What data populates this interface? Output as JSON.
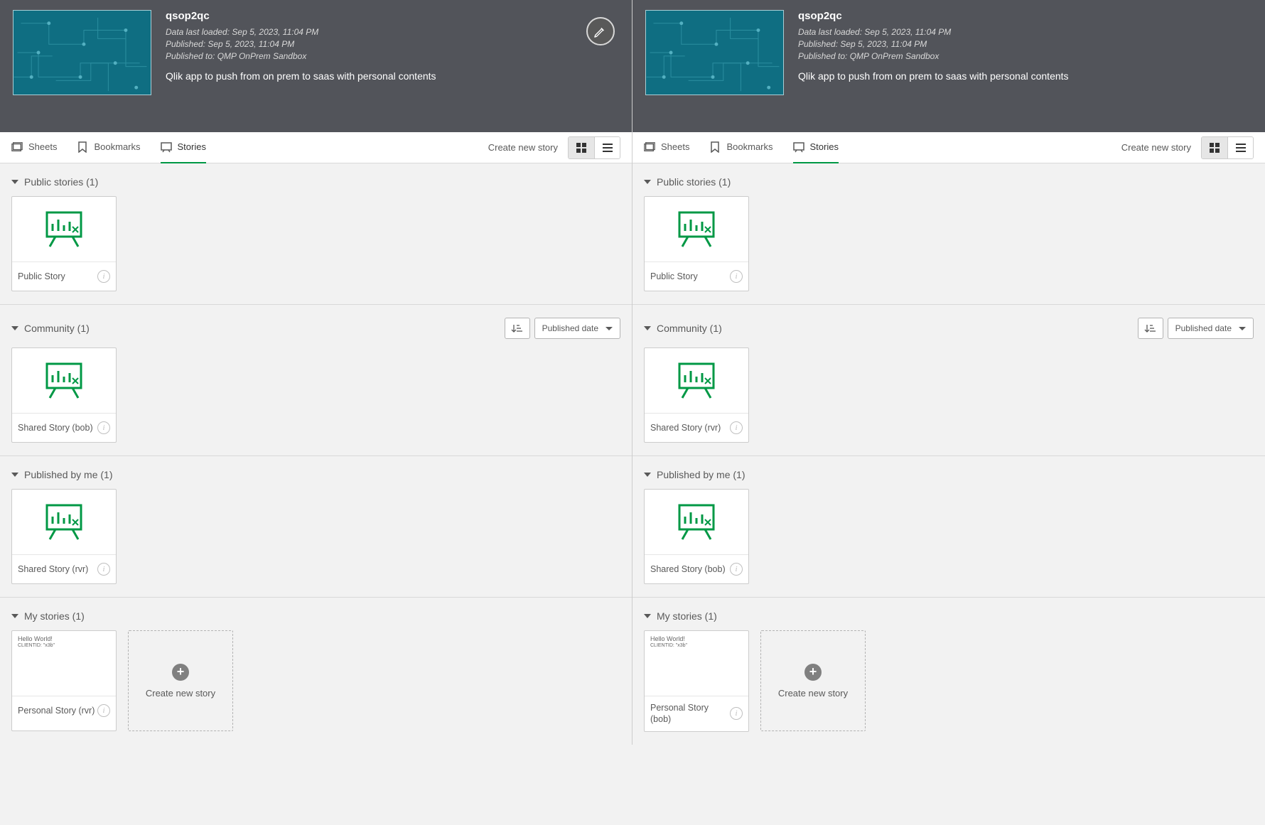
{
  "panes": [
    {
      "key": "left",
      "show_edit_button": true,
      "app_title": "qsop2qc",
      "data_last_loaded": "Data last loaded: Sep 5, 2023, 11:04 PM",
      "published": "Published: Sep 5, 2023, 11:04 PM",
      "published_to": "Published to: QMP OnPrem Sandbox",
      "app_description": "Qlik app to push from on prem to saas with personal contents",
      "tabs": {
        "sheets": "Sheets",
        "bookmarks": "Bookmarks",
        "stories": "Stories"
      },
      "create_new_story": "Create new story",
      "sections": {
        "public": {
          "title": "Public stories (1)",
          "card_label": "Public Story"
        },
        "community": {
          "title": "Community (1)",
          "card_label": "Shared Story (bob)",
          "sort_label": "Published date"
        },
        "published_by_me": {
          "title": "Published by me (1)",
          "card_label": "Shared Story (rvr)"
        },
        "my_stories": {
          "title": "My stories (1)",
          "card_label": "Personal Story (rvr)",
          "preview_line1": "Hello World!",
          "preview_line2": "CLIENTID: \"x3b\"",
          "create_label": "Create new story"
        }
      }
    },
    {
      "key": "right",
      "show_edit_button": false,
      "app_title": "qsop2qc",
      "data_last_loaded": "Data last loaded: Sep 5, 2023, 11:04 PM",
      "published": "Published: Sep 5, 2023, 11:04 PM",
      "published_to": "Published to: QMP OnPrem Sandbox",
      "app_description": "Qlik app to push from on prem to saas with personal contents",
      "tabs": {
        "sheets": "Sheets",
        "bookmarks": "Bookmarks",
        "stories": "Stories"
      },
      "create_new_story": "Create new story",
      "sections": {
        "public": {
          "title": "Public stories (1)",
          "card_label": "Public Story"
        },
        "community": {
          "title": "Community (1)",
          "card_label": "Shared Story (rvr)",
          "sort_label": "Published date"
        },
        "published_by_me": {
          "title": "Published by me (1)",
          "card_label": "Shared Story (bob)"
        },
        "my_stories": {
          "title": "My stories (1)",
          "card_label": "Personal Story (bob)",
          "preview_line1": "Hello World!",
          "preview_line2": "CLIENTID: \"x3b\"",
          "create_label": "Create new story"
        }
      }
    }
  ]
}
